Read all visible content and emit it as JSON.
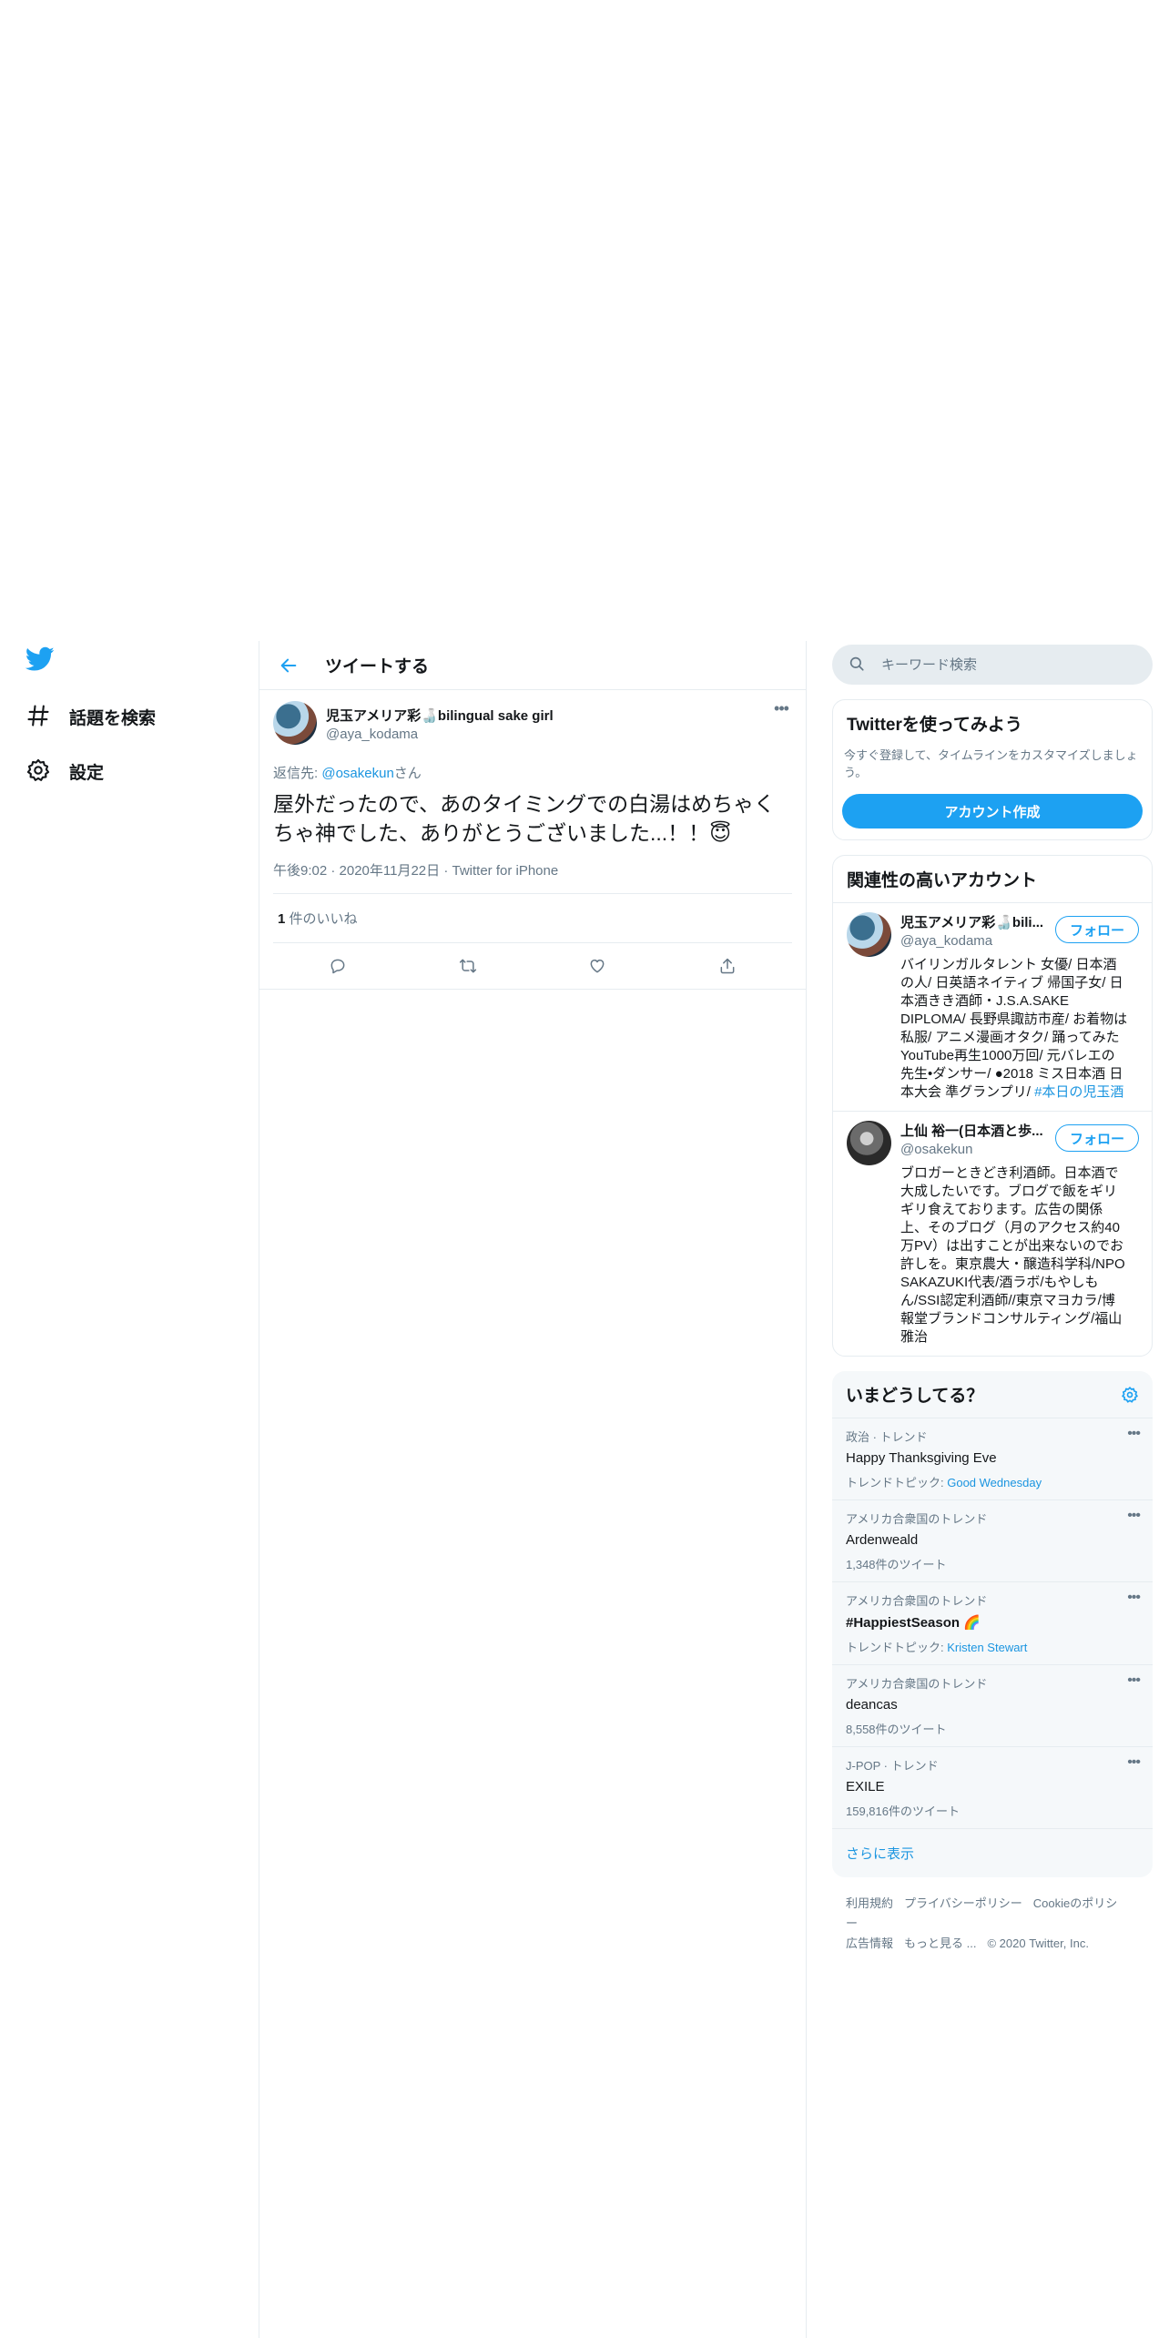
{
  "nav": {
    "items": [
      {
        "label": "話題を検索",
        "icon": "hashtag-icon"
      },
      {
        "label": "設定",
        "icon": "gear-icon"
      }
    ]
  },
  "header": {
    "title": "ツイートする"
  },
  "tweet": {
    "author_name": "児玉アメリア彩🍶bilingual sake girl",
    "author_handle": "@aya_kodama",
    "reply_prefix": "返信先: ",
    "reply_to": "@osakekun",
    "reply_suffix": "さん",
    "text": "屋外だったので、あのタイミングでの白湯はめちゃくちゃ神でした、ありがとうございました...！！😇",
    "time": "午後9:02 · 2020年11月22日 · Twitter for iPhone",
    "likes_count": "1",
    "likes_label": " 件のいいね"
  },
  "search": {
    "placeholder": "キーワード検索"
  },
  "signup": {
    "title": "Twitterを使ってみよう",
    "description": "今すぐ登録して、タイムラインをカスタマイズしましょう。",
    "button": "アカウント作成"
  },
  "related": {
    "title": "関連性の高いアカウント",
    "follow_label": "フォロー",
    "accounts": [
      {
        "name": "児玉アメリア彩🍶bili...",
        "handle": "@aya_kodama",
        "bio": "バイリンガルタレント 女優/ 日本酒の人/ 日英語ネイティブ 帰国子女/ 日本酒きき酒師・J.S.A.SAKE DIPLOMA/ 長野県諏訪市産/ お着物は私服/ アニメ漫画オタク/ 踊ってみたYouTube再生1000万回/ 元バレエの先生•ダンサー/ ●2018 ミス日本酒 日本大会 準グランプリ/ ",
        "bio_link": "#本日の児玉酒"
      },
      {
        "name": "上仙 裕一(日本酒と歩...",
        "handle": "@osakekun",
        "bio": "ブロガーときどき利酒師。日本酒で大成したいです。ブログで飯をギリギリ食えております。広告の関係上、そのブログ（月のアクセス約40万PV）は出すことが出来ないのでお許しを。東京農大・醸造科学科/NPO SAKAZUKI代表/酒ラボ/もやしもん/SSI認定利酒師//東京マヨカラ/博報堂ブランドコンサルティング/福山雅治",
        "bio_link": ""
      }
    ]
  },
  "trends": {
    "title": "いまどうしてる？",
    "items": [
      {
        "context": "政治 · トレンド",
        "name": "Happy Thanksgiving Eve",
        "sub_label": "トレンドトピック: ",
        "sub_link": "Good Wednesday",
        "bold": false
      },
      {
        "context": "アメリカ合衆国のトレンド",
        "name": "Ardenweald",
        "sub_label": "1,348件のツイート",
        "sub_link": "",
        "bold": false
      },
      {
        "context": "アメリカ合衆国のトレンド",
        "name": "#HappiestSeason 🌈",
        "sub_label": "トレンドトピック: ",
        "sub_link": "Kristen Stewart",
        "bold": true
      },
      {
        "context": "アメリカ合衆国のトレンド",
        "name": "deancas",
        "sub_label": "8,558件のツイート",
        "sub_link": "",
        "bold": false
      },
      {
        "context": "J-POP · トレンド",
        "name": "EXILE",
        "sub_label": "159,816件のツイート",
        "sub_link": "",
        "bold": false
      }
    ],
    "show_more": "さらに表示"
  },
  "footer": {
    "links": [
      "利用規約",
      "プライバシーポリシー",
      "Cookieのポリシー",
      "広告情報",
      "もっと見る ..."
    ],
    "copyright": "© 2020 Twitter, Inc."
  },
  "colors": {
    "accent": "#1da1f2",
    "link": "#1b95e0",
    "muted": "#657786",
    "border": "#e6ecf0"
  }
}
